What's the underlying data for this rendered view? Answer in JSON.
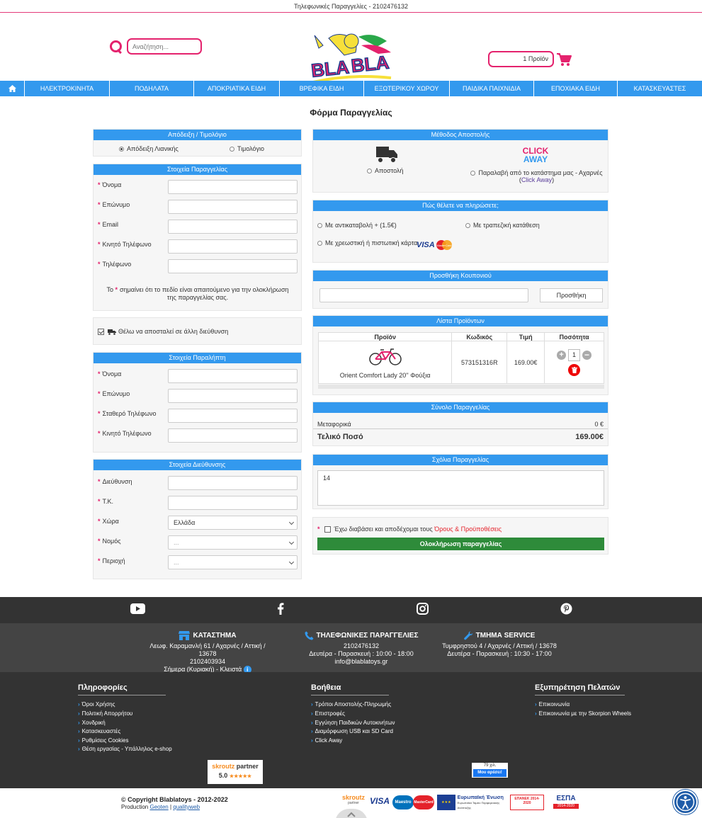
{
  "topbar": {
    "phone_text": "Τηλεφωνικές Παραγγελίες - 2102476132"
  },
  "header": {
    "search_placeholder": "Αναζήτηση...",
    "cart_label": "1 Προϊόν",
    "logo_text": "BLA BLA"
  },
  "nav": {
    "items": [
      "ΗΛΕΚΤΡΟΚΙΝΗΤΑ",
      "ΠΟΔΗΛΑΤΑ",
      "ΑΠΟΚΡΙΑΤΙΚΑ ΕΙΔΗ",
      "ΒΡΕΦΙΚΑ ΕΙΔΗ",
      "ΕΞΩΤΕΡΙΚΟΥ ΧΩΡΟΥ",
      "ΠΑΙΔΙΚΑ ΠΑΙΧΝΙΔΙΑ",
      "ΕΠΟΧΙΑΚΑ ΕΙΔΗ",
      "ΚΑΤΑΣΚΕΥΑΣΤΕΣ"
    ]
  },
  "page_title": "Φόρμα Παραγγελίας",
  "receipt": {
    "title": "Απόδειξη / Τιμολόγιο",
    "option_receipt": "Απόδειξη Λιανικής",
    "option_invoice": "Τιμολόγιο"
  },
  "order_details": {
    "title": "Στοιχεία Παραγγελίας",
    "fields": [
      "Όνομα",
      "Επώνυμο",
      "Email",
      "Κινητό Τηλέφωνο",
      "Τηλέφωνο"
    ],
    "note_before": "Το",
    "note_after": "σημαίνει ότι το πεδίο είναι απαιτούμενο για την ολοκλήρωση της παραγγελίας σας."
  },
  "ship_other": {
    "label": "Θέλω να αποσταλεί σε άλλη διεύθυνση"
  },
  "recipient": {
    "title": "Στοιχεία Παραλήπτη",
    "fields": [
      "Όνομα",
      "Επώνυμο",
      "Σταθερό Τηλέφωνο",
      "Κινητό Τηλέφωνο"
    ]
  },
  "address": {
    "title": "Στοιχεία Διεύθυνσης",
    "fields": [
      "Διεύθυνση",
      "Τ.Κ.",
      "Χώρα",
      "Νομός",
      "Περιοχή"
    ],
    "country_value": "Ελλάδα",
    "nomos_value": "...",
    "area_value": "..."
  },
  "shipping": {
    "title": "Μέθοδος Αποστολής",
    "option_ship": "Αποστολή",
    "option_pickup": "Παραλαβή από το κατάστημα μας - Αχαρνές (",
    "pickup_link": "Click Away",
    "pickup_close": ")",
    "click_away_logo_1": "CLICK",
    "click_away_logo_2": "AWAY"
  },
  "payment": {
    "title": "Πώς θέλετε να πληρώσετε;",
    "cod": "Με αντικαταβολή + (1.5€)",
    "bank": "Με τραπεζική κατάθεση",
    "card": "Με χρεωστική ή πιστωτική κάρτα",
    "visa": "VISA",
    "mastercard": "MasterCard"
  },
  "coupon": {
    "title": "Προσθήκη Κουπονιού",
    "button": "Προσθήκη"
  },
  "products": {
    "title": "Λίστα Προϊόντων",
    "headers": [
      "Προϊόν",
      "Κωδικός",
      "Τιμή",
      "Ποσότητα"
    ],
    "items": [
      {
        "name": "Orient Comfort Lady 20'' Φούξια",
        "code": "573151316R",
        "price": "169.00€",
        "qty": "1"
      }
    ]
  },
  "summary": {
    "title": "Σύνολο Παραγγελίας",
    "shipping_label": "Μεταφορικά",
    "shipping_value": "0 €",
    "total_label": "Τελικό Ποσό",
    "total_value": "169.00€"
  },
  "comments": {
    "title": "Σχόλια Παραγγελίας",
    "value": "14"
  },
  "terms": {
    "label": "Έχω διαβάσει και αποδέχομαι τους",
    "link": "Όρους & Προϋποθέσεις",
    "submit": "Ολοκλήρωση παραγγελίας"
  },
  "footer": {
    "store": {
      "title": "ΚΑΤΑΣΤΗΜΑ",
      "address": "Λεωφ. Καραμανλή 61 / Αχαρνές / Αττική / 13678",
      "phone": "2102403934",
      "status": "Σήμερα (Κυριακή) - Κλειστά",
      "info_glyph": "i"
    },
    "phone_orders": {
      "title": "ΤΗΛΕΦΩΝΙΚΕΣ ΠΑΡΑΓΓΕΛΙΕΣ",
      "phone": "2102476132",
      "hours": "Δευτέρα - Παρασκευή : 10:00 - 18:00",
      "email": "info@blablatoys.gr"
    },
    "service": {
      "title": "ΤΜΗΜΑ SERVICE",
      "address": "Τυμφρηστού 4 / Αχαρνές / Αττική / 13678",
      "hours": "Δευτέρα - Παρασκευή : 10:30 - 17:00"
    },
    "info_title": "Πληροφορίες",
    "info_links": [
      "Όροι Χρήσης",
      "Πολιτική Απορρήτου",
      "Χονδρική",
      "Κατασκευαστές",
      "Ρυθμίσεις Cookies",
      "Θέση εργασίας - Υπάλληλος e-shop"
    ],
    "help_title": "Βοήθεια",
    "help_links": [
      "Τρόποι Αποστολής-Πληρωμής",
      "Επιστροφές",
      "Εγγύηση Παιδικών Αυτοκινήτων",
      "Διαμόρφωση USB και SD Card",
      "Click Away"
    ],
    "support_title": "Εξυπηρέτηση Πελατών",
    "support_links": [
      "Επικοινωνία",
      "Επικοινωνία με την Skorpion Wheels"
    ],
    "skroutz_badge": {
      "brand": "skroutz",
      "label": "partner",
      "rating": "5.0",
      "stars": "★★★★★"
    },
    "fb_like": {
      "count": "79 χιλ.",
      "label": "Μου αρέσει!"
    },
    "copyright": "Copyright Blablatoys - 2012-2022",
    "production_label": "Production",
    "production_link1": "Geoten",
    "production_sep": "|",
    "production_link2": "qualityweb",
    "logos": {
      "skroutz": "skroutz",
      "skroutz_sub": "partner",
      "visa": "VISA",
      "maestro": "Maestro",
      "mastercard": "MasterCard",
      "eu_title": "Ευρωπαϊκή Ένωση",
      "eu_sub": "Ευρωπαϊκό Ταμείο Περιφερειακής Ανάπτυξης",
      "epanek": "ΕΠΑΝΕΚ 2014-2020",
      "espa": "ΕΣΠΑ",
      "espa_years": "2014-2020"
    }
  }
}
